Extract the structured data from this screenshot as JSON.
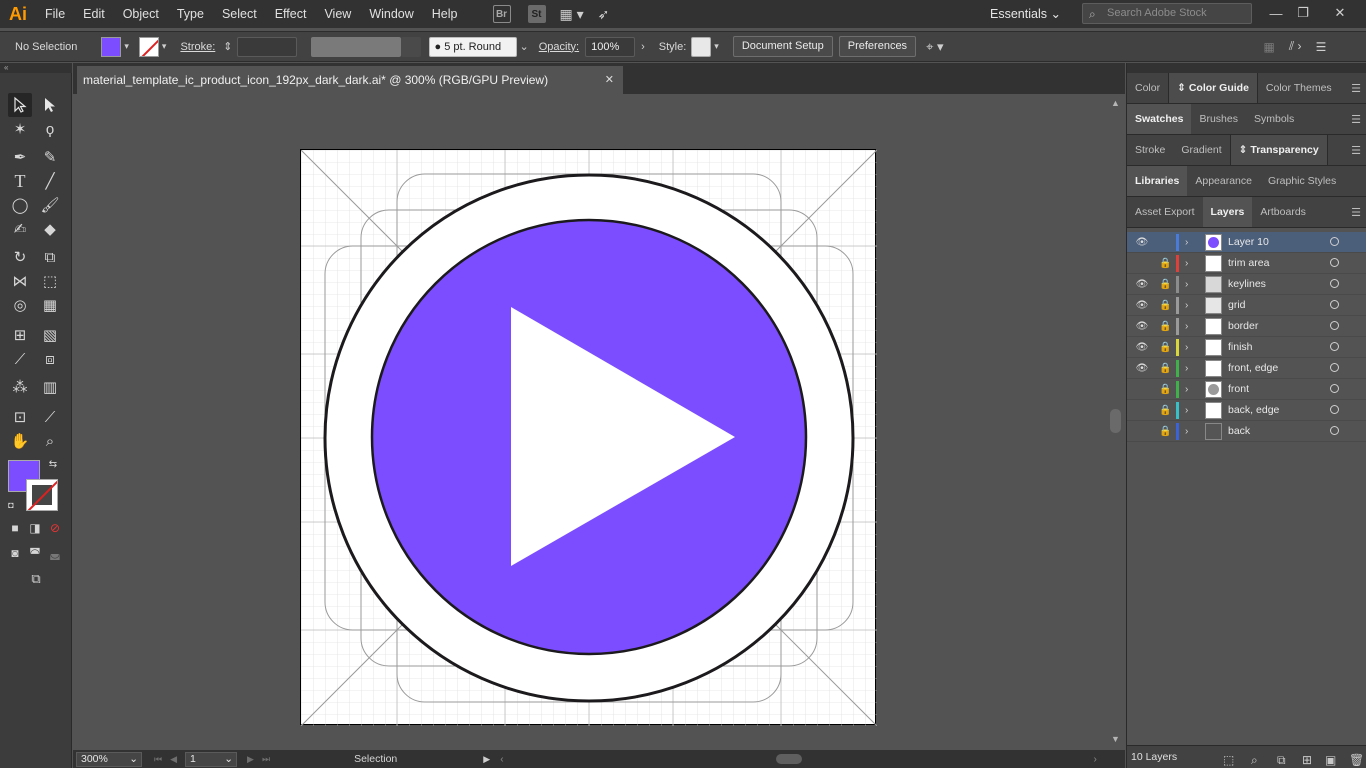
{
  "app": {
    "logo": "Ai"
  },
  "menu": [
    "File",
    "Edit",
    "Object",
    "Type",
    "Select",
    "Effect",
    "View",
    "Window",
    "Help"
  ],
  "app_icons": {
    "bridge": "Br",
    "stock": "St"
  },
  "workspace": {
    "label": "Essentials"
  },
  "stock_search": {
    "placeholder": "Search Adobe Stock"
  },
  "control": {
    "selection": "No Selection",
    "stroke_label": "Stroke:",
    "brush": "5 pt. Round",
    "opacity_label": "Opacity:",
    "opacity_value": "100%",
    "style_label": "Style:",
    "document_setup": "Document Setup",
    "preferences": "Preferences"
  },
  "document_tab": {
    "title": "material_template_ic_product_icon_192px_dark_dark.ai* @ 300% (RGB/GPU Preview)",
    "close": "✕"
  },
  "status": {
    "zoom": "300%",
    "artboard": "1",
    "tool": "Selection"
  },
  "panels": {
    "row1": [
      "Color",
      "Color Guide",
      "Color Themes"
    ],
    "row2": [
      "Swatches",
      "Brushes",
      "Symbols"
    ],
    "row3": [
      "Stroke",
      "Gradient",
      "Transparency"
    ],
    "row4": [
      "Libraries",
      "Appearance",
      "Graphic Styles"
    ],
    "row5": [
      "Asset Export",
      "Layers",
      "Artboards"
    ]
  },
  "layers": [
    {
      "name": "Layer 10",
      "color": "#4a7bd6",
      "visible": true,
      "locked": false,
      "selected": true
    },
    {
      "name": "trim area",
      "color": "#e0403a",
      "visible": false,
      "locked": true,
      "selected": false
    },
    {
      "name": "keylines",
      "color": "#8c8c8c",
      "visible": true,
      "locked": true,
      "selected": false
    },
    {
      "name": "grid",
      "color": "#9a9a9a",
      "visible": true,
      "locked": true,
      "selected": false
    },
    {
      "name": "border",
      "color": "#9a9a9a",
      "visible": true,
      "locked": true,
      "selected": false
    },
    {
      "name": "finish",
      "color": "#d8d83a",
      "visible": true,
      "locked": true,
      "selected": false
    },
    {
      "name": "front, edge",
      "color": "#3fb04a",
      "visible": true,
      "locked": true,
      "selected": false
    },
    {
      "name": "front",
      "color": "#3fb04a",
      "visible": false,
      "locked": true,
      "selected": false
    },
    {
      "name": "back, edge",
      "color": "#38c0c8",
      "visible": false,
      "locked": true,
      "selected": false
    },
    {
      "name": "back",
      "color": "#3a63d8",
      "visible": false,
      "locked": true,
      "selected": false
    }
  ],
  "layers_count": "10 Layers",
  "colors": {
    "fill": "#7c4dff",
    "accent_selected": "#4b5e7a"
  }
}
